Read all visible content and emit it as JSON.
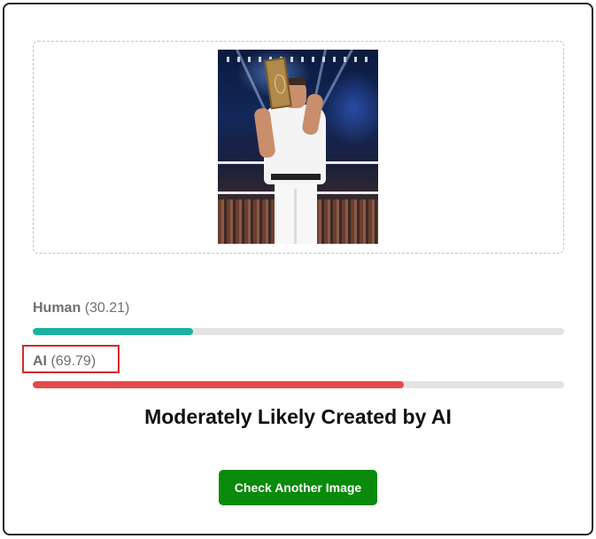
{
  "results": [
    {
      "label": "Human",
      "score": "(30.21)",
      "fraction": 0.3021,
      "color": "#1bb3a0"
    },
    {
      "label": "AI",
      "score": "(69.79)",
      "fraction": 0.6979,
      "color": "#e24a4a"
    }
  ],
  "verdict": "Moderately Likely Created by AI",
  "button": {
    "label": "Check Another Image",
    "color": "#0a8a0a"
  },
  "highlight_color": "#d42a2a"
}
